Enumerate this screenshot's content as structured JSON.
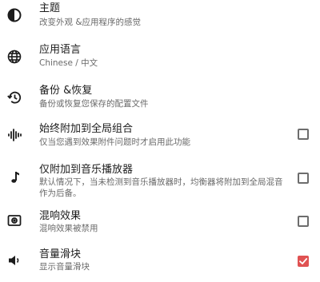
{
  "settings": [
    {
      "title": "主题",
      "subtitle": "改变外观 &应用程序的感觉",
      "icon": "theme-contrast-icon"
    },
    {
      "title": "应用语言",
      "subtitle": "Chinese / 中文",
      "icon": "globe-icon"
    },
    {
      "title": "备份 &恢复",
      "subtitle": "备份或恢复您保存的配置文件",
      "icon": "history-restore-icon"
    },
    {
      "title": "始终附加到全局组合",
      "subtitle": "仅当您遇到效果附件问题时才启用此功能",
      "icon": "waveform-icon",
      "checked": false
    },
    {
      "title": "仅附加到音乐播放器",
      "subtitle": "默认情况下，当未检测到音乐播放器时，均衡器将附加到全局混音作为后备。",
      "icon": "music-note-icon",
      "checked": false
    },
    {
      "title": "混响效果",
      "subtitle": "混响效果被禁用",
      "icon": "reverb-speaker-icon",
      "checked": false
    },
    {
      "title": "音量滑块",
      "subtitle": "显示音量滑块",
      "icon": "volume-icon",
      "checked": true
    }
  ],
  "colors": {
    "accent": "#e05252",
    "text": "#1c1c1c",
    "subtext": "#6a6a6a",
    "checkbox_border": "#6d6d6d"
  }
}
